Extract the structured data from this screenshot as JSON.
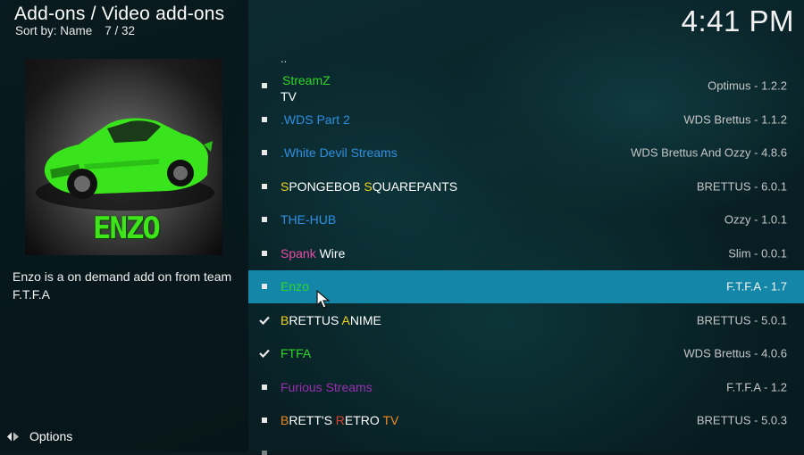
{
  "header": {
    "title": "Add-ons / Video add-ons",
    "sort_label": "Sort by: Name",
    "position": "7 / 32",
    "clock": "4:41 PM"
  },
  "thumbnail": {
    "text": "ENZO",
    "text_color": "#3ee619",
    "car_color": "#39e61b"
  },
  "description": "Enzo is a on demand add on from team F.T.F.A",
  "footer": {
    "options_label": "Options"
  },
  "list": {
    "parent_label": "..",
    "items": [
      {
        "name_line1": "StreamZ",
        "name_line2": "TV",
        "version": "Optimus - 1.2.2",
        "marker": "square"
      },
      {
        "name": ".WDS Part 2",
        "version": "WDS Brettus - 1.1.2",
        "marker": "square"
      },
      {
        "name": ".White Devil Streams",
        "version": "WDS Brettus And Ozzy - 4.8.6",
        "marker": "square"
      },
      {
        "name_parts": [
          "S",
          "PONGEBOB ",
          "S",
          "QUAREPANTS"
        ],
        "version": "BRETTUS - 6.0.1",
        "marker": "square"
      },
      {
        "name": "THE-HUB",
        "version": "Ozzy - 1.0.1",
        "marker": "square"
      },
      {
        "name_parts": [
          "Spank",
          " Wire"
        ],
        "version": "Slim - 0.0.1",
        "marker": "square"
      },
      {
        "name": "Enzo",
        "version": "F.T.F.A - 1.7",
        "marker": "square",
        "selected": true
      },
      {
        "name_parts": [
          "B",
          "RETTUS ",
          "A",
          "NIME"
        ],
        "version": "BRETTUS - 5.0.1",
        "marker": "check"
      },
      {
        "name": "FTFA",
        "version": "WDS Brettus - 4.0.6",
        "marker": "check"
      },
      {
        "name": "Furious Streams",
        "version": "F.T.F.A - 1.2",
        "marker": "square"
      },
      {
        "name_parts": [
          "B",
          "RETT'S ",
          "R",
          "ETRO ",
          "TV"
        ],
        "version": "BRETTUS - 5.0.3",
        "marker": "square"
      }
    ]
  },
  "colors": {
    "accent": "#1487a8",
    "green": "#2fd62a",
    "blue": "#2f8fe0",
    "purple": "#9b2fb0",
    "red": "#e0402a",
    "yellow": "#f2d21e",
    "pink": "#e84ba8",
    "orange": "#f08a24",
    "white": "#ffffff"
  }
}
